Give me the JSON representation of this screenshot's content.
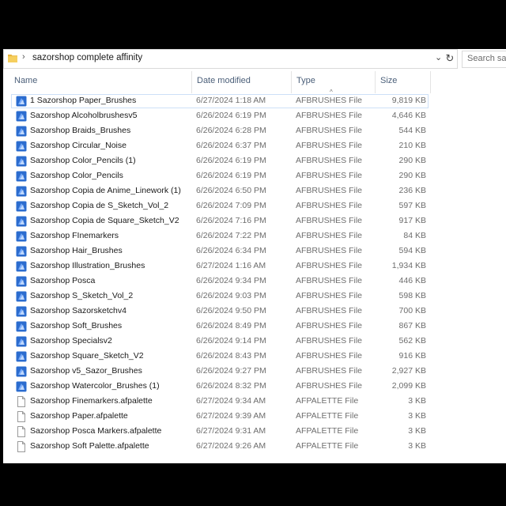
{
  "address": {
    "path": "sazorshop complete affinity",
    "search_placeholder": "Search saz"
  },
  "columns": {
    "name": "Name",
    "date": "Date modified",
    "type": "Type",
    "size": "Size"
  },
  "colors": {
    "affinity_icon": "#2b6ccf",
    "palette_icon": "#ffffff",
    "selection_border": "#cde0f7"
  },
  "files": [
    {
      "name": "1 Sazorshop Paper_Brushes",
      "date": "6/27/2024 1:18 AM",
      "type": "AFBRUSHES File",
      "size": "9,819 KB",
      "icon": "affinity-brush-icon",
      "selected": true
    },
    {
      "name": "Sazorshop Alcoholbrushesv5",
      "date": "6/26/2024 6:19 PM",
      "type": "AFBRUSHES File",
      "size": "4,646 KB",
      "icon": "affinity-brush-icon"
    },
    {
      "name": "Sazorshop Braids_Brushes",
      "date": "6/26/2024 6:28 PM",
      "type": "AFBRUSHES File",
      "size": "544 KB",
      "icon": "affinity-brush-icon"
    },
    {
      "name": "Sazorshop Circular_Noise",
      "date": "6/26/2024 6:37 PM",
      "type": "AFBRUSHES File",
      "size": "210 KB",
      "icon": "affinity-brush-icon"
    },
    {
      "name": "Sazorshop Color_Pencils (1)",
      "date": "6/26/2024 6:19 PM",
      "type": "AFBRUSHES File",
      "size": "290 KB",
      "icon": "affinity-brush-icon"
    },
    {
      "name": "Sazorshop Color_Pencils",
      "date": "6/26/2024 6:19 PM",
      "type": "AFBRUSHES File",
      "size": "290 KB",
      "icon": "affinity-brush-icon"
    },
    {
      "name": "Sazorshop Copia de Anime_Linework (1)",
      "date": "6/26/2024 6:50 PM",
      "type": "AFBRUSHES File",
      "size": "236 KB",
      "icon": "affinity-brush-icon"
    },
    {
      "name": "Sazorshop Copia de S_Sketch_Vol_2",
      "date": "6/26/2024 7:09 PM",
      "type": "AFBRUSHES File",
      "size": "597 KB",
      "icon": "affinity-brush-icon"
    },
    {
      "name": "Sazorshop Copia de Square_Sketch_V2",
      "date": "6/26/2024 7:16 PM",
      "type": "AFBRUSHES File",
      "size": "917 KB",
      "icon": "affinity-brush-icon"
    },
    {
      "name": "Sazorshop FInemarkers",
      "date": "6/26/2024 7:22 PM",
      "type": "AFBRUSHES File",
      "size": "84 KB",
      "icon": "affinity-brush-icon"
    },
    {
      "name": "Sazorshop Hair_Brushes",
      "date": "6/26/2024 6:34 PM",
      "type": "AFBRUSHES File",
      "size": "594 KB",
      "icon": "affinity-brush-icon"
    },
    {
      "name": "Sazorshop Illustration_Brushes",
      "date": "6/27/2024 1:16 AM",
      "type": "AFBRUSHES File",
      "size": "1,934 KB",
      "icon": "affinity-brush-icon"
    },
    {
      "name": "Sazorshop Posca",
      "date": "6/26/2024 9:34 PM",
      "type": "AFBRUSHES File",
      "size": "446 KB",
      "icon": "affinity-brush-icon"
    },
    {
      "name": "Sazorshop S_Sketch_Vol_2",
      "date": "6/26/2024 9:03 PM",
      "type": "AFBRUSHES File",
      "size": "598 KB",
      "icon": "affinity-brush-icon"
    },
    {
      "name": "Sazorshop Sazorsketchv4",
      "date": "6/26/2024 9:50 PM",
      "type": "AFBRUSHES File",
      "size": "700 KB",
      "icon": "affinity-brush-icon"
    },
    {
      "name": "Sazorshop Soft_Brushes",
      "date": "6/26/2024 8:49 PM",
      "type": "AFBRUSHES File",
      "size": "867 KB",
      "icon": "affinity-brush-icon"
    },
    {
      "name": "Sazorshop Specialsv2",
      "date": "6/26/2024 9:14 PM",
      "type": "AFBRUSHES File",
      "size": "562 KB",
      "icon": "affinity-brush-icon"
    },
    {
      "name": "Sazorshop Square_Sketch_V2",
      "date": "6/26/2024 8:43 PM",
      "type": "AFBRUSHES File",
      "size": "916 KB",
      "icon": "affinity-brush-icon"
    },
    {
      "name": "Sazorshop v5_Sazor_Brushes",
      "date": "6/26/2024 9:27 PM",
      "type": "AFBRUSHES File",
      "size": "2,927 KB",
      "icon": "affinity-brush-icon"
    },
    {
      "name": "Sazorshop Watercolor_Brushes (1)",
      "date": "6/26/2024 8:32 PM",
      "type": "AFBRUSHES File",
      "size": "2,099 KB",
      "icon": "affinity-brush-icon"
    },
    {
      "name": "Sazorshop Finemarkers.afpalette",
      "date": "6/27/2024 9:34 AM",
      "type": "AFPALETTE File",
      "size": "3 KB",
      "icon": "document-icon"
    },
    {
      "name": "Sazorshop Paper.afpalette",
      "date": "6/27/2024 9:39 AM",
      "type": "AFPALETTE File",
      "size": "3 KB",
      "icon": "document-icon"
    },
    {
      "name": "Sazorshop Posca Markers.afpalette",
      "date": "6/27/2024 9:31 AM",
      "type": "AFPALETTE File",
      "size": "3 KB",
      "icon": "document-icon"
    },
    {
      "name": "Sazorshop Soft Palette.afpalette",
      "date": "6/27/2024 9:26 AM",
      "type": "AFPALETTE File",
      "size": "3 KB",
      "icon": "document-icon"
    }
  ]
}
